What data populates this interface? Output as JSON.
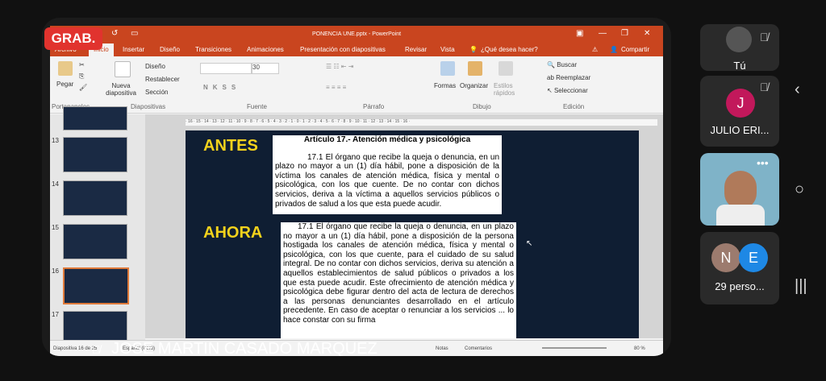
{
  "powerpoint": {
    "window_title": "PONENCIA UNE.pptx - PowerPoint",
    "tabs": [
      "Archivo",
      "Inicio",
      "Insertar",
      "Diseño",
      "Transiciones",
      "Animaciones",
      "Presentación con diapositivas",
      "Revisar",
      "Vista"
    ],
    "search_placeholder": "¿Qué desea hacer?",
    "share": "Compartir",
    "ribbon": {
      "paste": "Pegar",
      "new_slide": "Nueva diapositiva",
      "design": "Diseño",
      "reset": "Restablecer",
      "section": "Sección",
      "font_size": "30",
      "shapes": "Formas",
      "arrange": "Organizar",
      "quick_styles": "Estilos rápidos",
      "find": "Buscar",
      "replace": "Reemplazar",
      "select": "Seleccionar",
      "groups": [
        "Portapapeles",
        "Diapositivas",
        "Fuente",
        "Párrafo",
        "Dibujo",
        "Edición"
      ]
    },
    "thumb_numbers": [
      "13",
      "14",
      "15",
      "16",
      "17"
    ],
    "slide": {
      "before_label": "ANTES",
      "before_title": "Artículo 17.- Atención médica y psicológica",
      "before_text": "17.1 El órgano que recibe la queja o denuncia, en un plazo no mayor a un (1) día hábil, pone a disposición de la víctima los canales de atención médica, física y mental o psicológica, con los que cuente. De no contar con dichos servicios, deriva a la víctima a aquellos servicios públicos o privados de salud a los que esta puede acudir.",
      "after_label": "AHORA",
      "after_text": "17.1 El órgano que recibe la queja o denuncia, en un plazo no mayor a un (1) día hábil, pone a disposición de la persona hostigada los canales de atención médica, física y mental o psicológica, con los que cuente, para el cuidado de su salud integral. De no contar con dichos servicios, deriva su atención a aquellos establecimientos de salud públicos o privados a los que esta puede acudir. Este ofrecimiento de atención médica y psicológica debe figurar dentro del acta de lectura de derechos a las personas denunciantes desarrollado en el artículo precedente. En caso de aceptar o renunciar a los servicios ... lo hace constar con su firma"
    },
    "status": {
      "slide_counter": "Diapositiva 16 de 25",
      "language": "Español (Perú)",
      "notes": "Notas",
      "comments": "Comentarios",
      "zoom": "80 %"
    }
  },
  "meeting": {
    "recording_badge": "GRAB.",
    "presenter_name": "JOSE MARTIN CASADO MARQUEZ",
    "tiles": {
      "self": "Tú",
      "julio_initial": "J",
      "julio_name": "JULIO ERI...",
      "avatar_n": "N",
      "avatar_e": "E",
      "others": "29 perso..."
    }
  },
  "colors": {
    "ppt_red": "#c9451f",
    "slide_bg": "#0f1e33",
    "label_yellow": "#f3d21c",
    "rec_red": "#e1332e",
    "julio_pink": "#c2185b"
  }
}
